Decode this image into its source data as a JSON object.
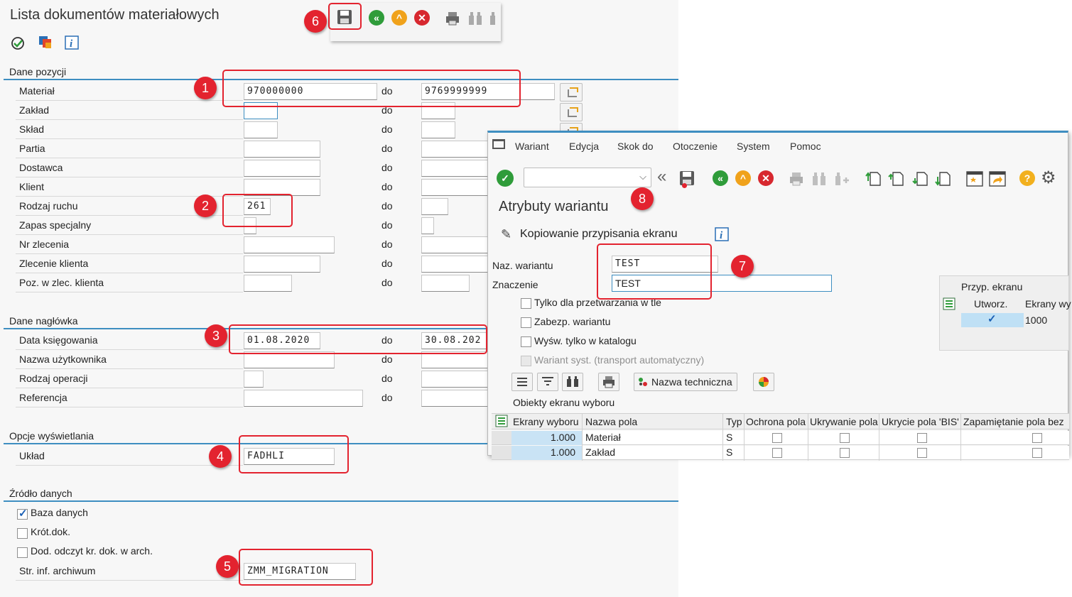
{
  "main": {
    "title": "Lista dokumentów materiałowych",
    "sections": {
      "dane_pozycji": "Dane pozycji",
      "dane_naglowka": "Dane nagłówka",
      "opcje": "Opcje wyświetlania",
      "zrodlo": "Źródło danych"
    },
    "do_label": "do",
    "dane_pozycji_rows": [
      {
        "label": "Materiał",
        "from": "970000000",
        "to": "9769999999"
      },
      {
        "label": "Zakład",
        "from": "",
        "to": ""
      },
      {
        "label": "Skład",
        "from": "",
        "to": ""
      },
      {
        "label": "Partia",
        "from": "",
        "to": ""
      },
      {
        "label": "Dostawca",
        "from": "",
        "to": ""
      },
      {
        "label": "Klient",
        "from": "",
        "to": ""
      },
      {
        "label": "Rodzaj ruchu",
        "from": "261",
        "to": ""
      },
      {
        "label": "Zapas specjalny",
        "from": "",
        "to": ""
      },
      {
        "label": "Nr zlecenia",
        "from": "",
        "to": ""
      },
      {
        "label": "Zlecenie klienta",
        "from": "",
        "to": ""
      },
      {
        "label": "Poz. w zlec. klienta",
        "from": "",
        "to": ""
      }
    ],
    "dane_naglowka_rows": [
      {
        "label": "Data księgowania",
        "from": "01.08.2020",
        "to": "30.08.202"
      },
      {
        "label": "Nazwa użytkownika",
        "from": "",
        "to": ""
      },
      {
        "label": "Rodzaj operacji",
        "from": "",
        "to": ""
      },
      {
        "label": "Referencja",
        "from": "",
        "to": ""
      }
    ],
    "uklad": {
      "label": "Układ",
      "value": "FADHLI"
    },
    "zrodlo_options": [
      {
        "label": "Baza danych",
        "checked": true
      },
      {
        "label": "Krót.dok.",
        "checked": false
      },
      {
        "label": "Dod. odczyt kr. dok. w arch.",
        "checked": false
      }
    ],
    "archiwum": {
      "label": "Str. inf. archiwum",
      "value": "ZMM_MIGRATION"
    }
  },
  "annotations": [
    "1",
    "2",
    "3",
    "4",
    "5",
    "6",
    "7",
    "8"
  ],
  "popup": {
    "menu": [
      "Wariant",
      "Edycja",
      "Skok do",
      "Otoczenie",
      "System",
      "Pomoc"
    ],
    "title": "Atrybuty wariantu",
    "copy_label": "Kopiowanie przypisania ekranu",
    "naz_wariantu_label": "Naz. wariantu",
    "naz_wariantu_value": "TEST",
    "znaczenie_label": "Znaczenie",
    "znaczenie_value": "TEST",
    "options": [
      {
        "label": "Tylko dla przetwarzania w tle",
        "checked": false,
        "disabled": false
      },
      {
        "label": "Zabezp. wariantu",
        "checked": false,
        "disabled": false
      },
      {
        "label": "Wyśw. tylko w katalogu",
        "checked": false,
        "disabled": false
      },
      {
        "label": "Wariant syst. (transport automatyczny)",
        "checked": false,
        "disabled": true
      }
    ],
    "przyp_ekranu": {
      "title": "Przyp. ekranu",
      "col_utworz": "Utworz.",
      "col_ekrany": "Ekrany wy",
      "row_value": "1000"
    },
    "nazwa_techniczna": "Nazwa techniczna",
    "obiekty_title": "Obiekty ekranu wyboru",
    "grid_headers": [
      "Ekrany wyboru",
      "Nazwa pola",
      "Typ",
      "Ochrona pola",
      "Ukrywanie pola",
      "Ukrycie pola 'BIS'",
      "Zapamiętanie pola bez"
    ],
    "grid_rows": [
      {
        "ekrany": "1.000",
        "nazwa": "Materiał",
        "typ": "S"
      },
      {
        "ekrany": "1.000",
        "nazwa": "Zakład",
        "typ": "S"
      }
    ],
    "colors": {
      "accent": "#3e8ec1",
      "annotation": "#e3232f"
    }
  }
}
